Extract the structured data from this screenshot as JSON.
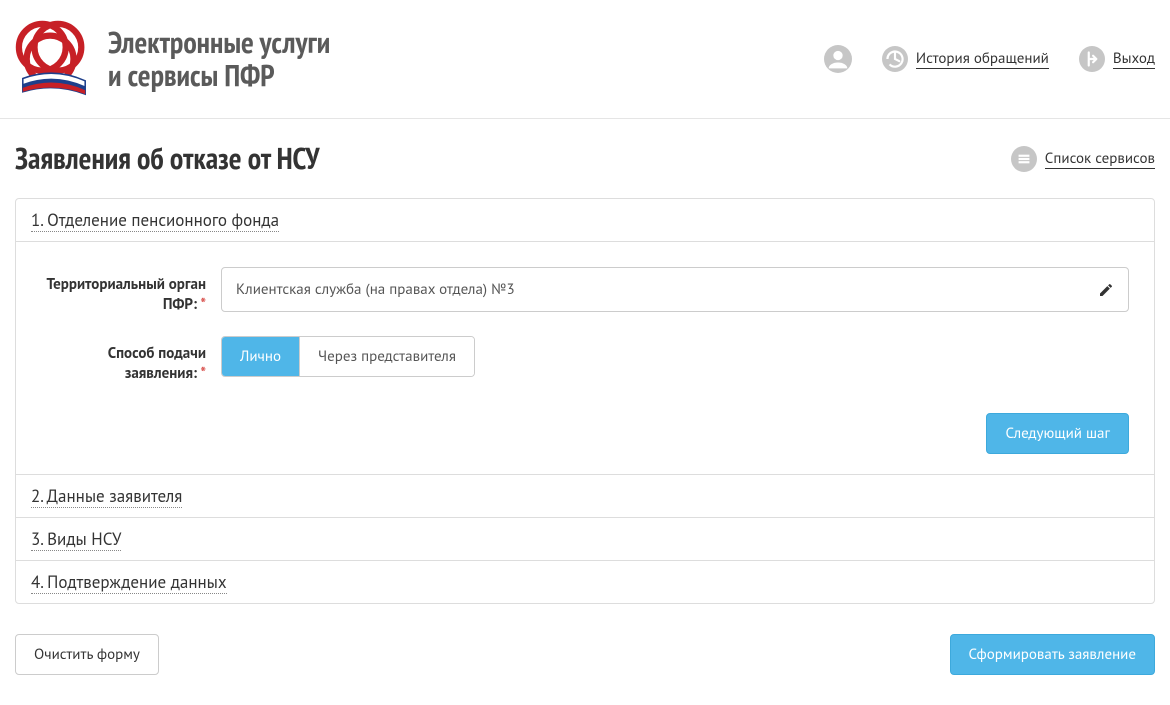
{
  "header": {
    "brand_line1": "Электронные услуги",
    "brand_line2": "и сервисы ПФР",
    "history_link": "История обращений",
    "logout_link": "Выход"
  },
  "page": {
    "title": "Заявления об отказе от НСУ",
    "services_link": "Список сервисов"
  },
  "steps": {
    "s1": {
      "title": "1. Отделение пенсионного фонда",
      "territory_label": "Территориальный орган ПФР:",
      "territory_value": "Клиентская служба (на правах отдела) №3",
      "method_label": "Способ подачи заявления:",
      "method_options": {
        "personal": "Лично",
        "rep": "Через представителя"
      },
      "next_btn": "Следующий шаг"
    },
    "s2": {
      "title": "2. Данные заявителя"
    },
    "s3": {
      "title": "3. Виды НСУ"
    },
    "s4": {
      "title": "4. Подтверждение данных"
    }
  },
  "actions": {
    "clear": "Очистить форму",
    "submit": "Сформировать заявление"
  }
}
